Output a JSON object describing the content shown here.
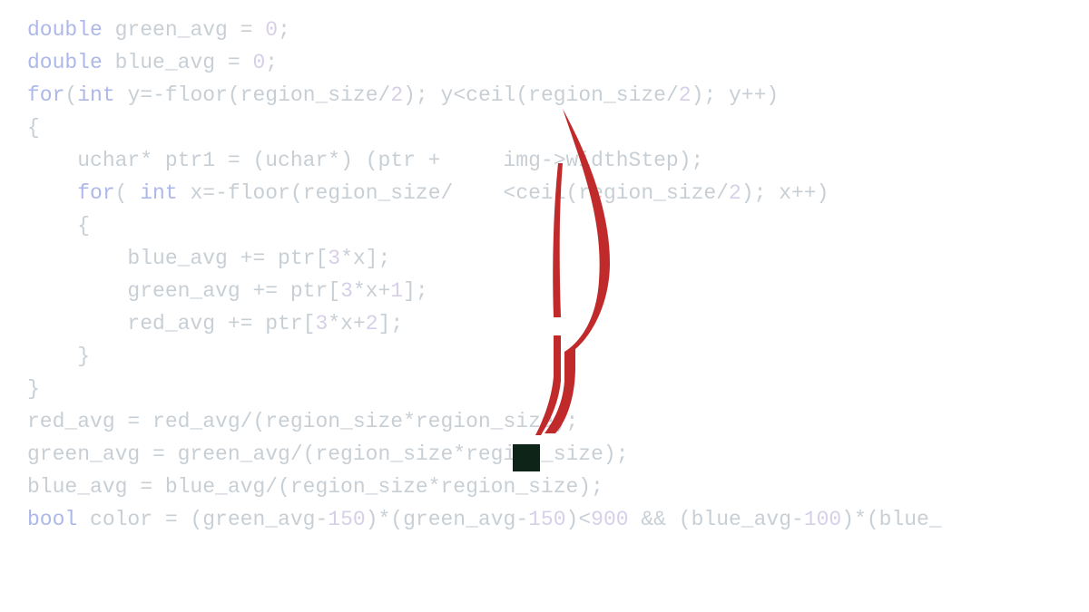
{
  "code": {
    "lines": [
      {
        "indent": 0,
        "tokens": [
          {
            "t": "double",
            "c": "kw"
          },
          {
            "t": " green_avg = ",
            "c": ""
          },
          {
            "t": "0",
            "c": "num"
          },
          {
            "t": ";",
            "c": ""
          }
        ]
      },
      {
        "indent": 0,
        "tokens": [
          {
            "t": "double",
            "c": "kw"
          },
          {
            "t": " blue_avg = ",
            "c": ""
          },
          {
            "t": "0",
            "c": "num"
          },
          {
            "t": ";",
            "c": ""
          }
        ]
      },
      {
        "indent": 0,
        "tokens": [
          {
            "t": "",
            "c": ""
          }
        ]
      },
      {
        "indent": 0,
        "tokens": [
          {
            "t": "for",
            "c": "kw"
          },
          {
            "t": "(",
            "c": ""
          },
          {
            "t": "int",
            "c": "kw"
          },
          {
            "t": " y=-floor(region_size/",
            "c": ""
          },
          {
            "t": "2",
            "c": "num"
          },
          {
            "t": "); y<ceil(region_size/",
            "c": ""
          },
          {
            "t": "2",
            "c": "num"
          },
          {
            "t": "); y++)",
            "c": ""
          }
        ]
      },
      {
        "indent": 0,
        "tokens": [
          {
            "t": "{",
            "c": ""
          }
        ]
      },
      {
        "indent": 1,
        "tokens": [
          {
            "t": "uchar* ptr1 = (uchar*) (ptr +     img->widthStep);",
            "c": ""
          }
        ]
      },
      {
        "indent": 1,
        "tokens": [
          {
            "t": "for",
            "c": "kw"
          },
          {
            "t": "( ",
            "c": ""
          },
          {
            "t": "int",
            "c": "kw"
          },
          {
            "t": " x=-floor(region_size/    <ceil(region_size/",
            "c": ""
          },
          {
            "t": "2",
            "c": "num"
          },
          {
            "t": "); x++)",
            "c": ""
          }
        ]
      },
      {
        "indent": 1,
        "tokens": [
          {
            "t": "{",
            "c": ""
          }
        ]
      },
      {
        "indent": 2,
        "tokens": [
          {
            "t": "blue_avg += ptr[",
            "c": ""
          },
          {
            "t": "3",
            "c": "num"
          },
          {
            "t": "*x];",
            "c": ""
          }
        ]
      },
      {
        "indent": 2,
        "tokens": [
          {
            "t": "green_avg += ptr[",
            "c": ""
          },
          {
            "t": "3",
            "c": "num"
          },
          {
            "t": "*x+",
            "c": ""
          },
          {
            "t": "1",
            "c": "num"
          },
          {
            "t": "];",
            "c": ""
          }
        ]
      },
      {
        "indent": 2,
        "tokens": [
          {
            "t": "red_avg += ptr[",
            "c": ""
          },
          {
            "t": "3",
            "c": "num"
          },
          {
            "t": "*x+",
            "c": ""
          },
          {
            "t": "2",
            "c": "num"
          },
          {
            "t": "];",
            "c": ""
          }
        ]
      },
      {
        "indent": 1,
        "tokens": [
          {
            "t": "}",
            "c": ""
          }
        ]
      },
      {
        "indent": 0,
        "tokens": [
          {
            "t": "}",
            "c": ""
          }
        ]
      },
      {
        "indent": 0,
        "tokens": [
          {
            "t": "red_avg = red_avg/(region_size*region_size);",
            "c": ""
          }
        ]
      },
      {
        "indent": 0,
        "tokens": [
          {
            "t": "green_avg = green_avg/(region_size*region_size);",
            "c": ""
          }
        ]
      },
      {
        "indent": 0,
        "tokens": [
          {
            "t": "blue_avg = blue_avg/(region_size*region_size);",
            "c": ""
          }
        ]
      },
      {
        "indent": 0,
        "tokens": [
          {
            "t": "",
            "c": ""
          }
        ]
      },
      {
        "indent": 0,
        "tokens": [
          {
            "t": "bool",
            "c": "kw"
          },
          {
            "t": " color = (green_avg-",
            "c": ""
          },
          {
            "t": "150",
            "c": "num"
          },
          {
            "t": ")*(green_avg-",
            "c": ""
          },
          {
            "t": "150",
            "c": "num"
          },
          {
            "t": ")<",
            "c": ""
          },
          {
            "t": "900",
            "c": "num"
          },
          {
            "t": " && (blue_avg-",
            "c": ""
          },
          {
            "t": "100",
            "c": "num"
          },
          {
            "t": ")*(blue_",
            "c": ""
          }
        ]
      }
    ]
  },
  "overlay": {
    "quill_icon": "quill-pen-icon",
    "quill_color": "#c02a2a",
    "square_color": "#0e2418"
  }
}
